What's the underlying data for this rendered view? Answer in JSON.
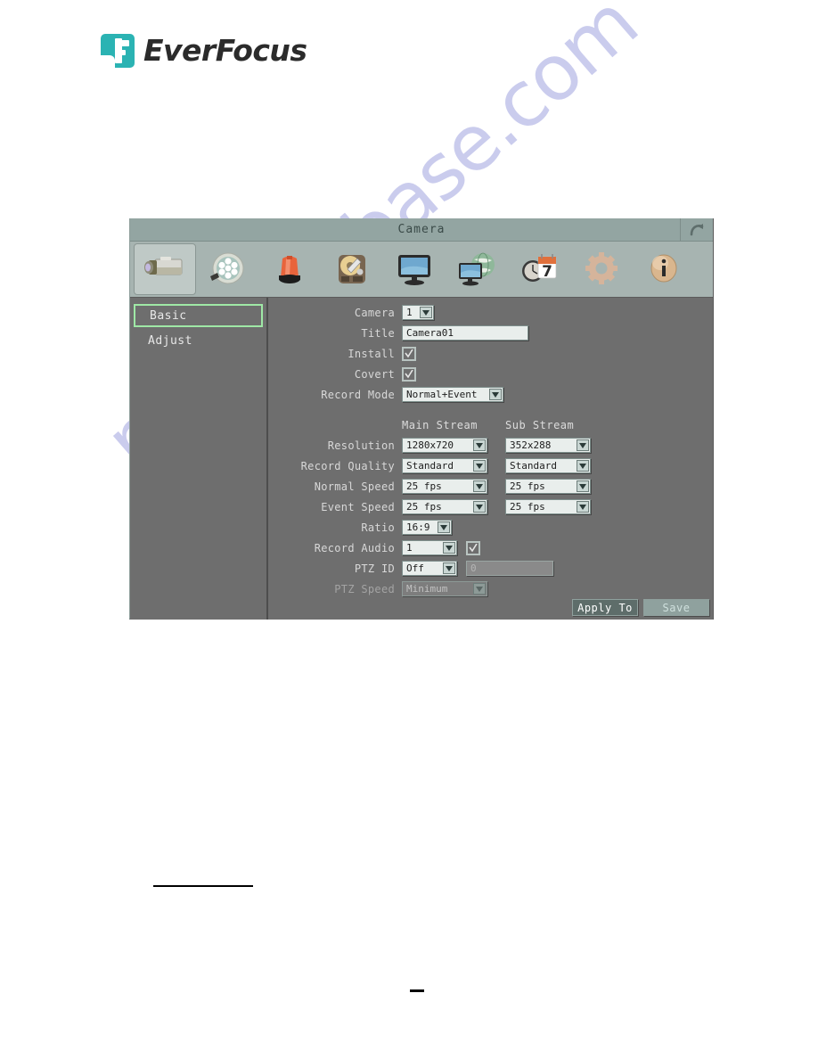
{
  "brand": {
    "name": "EverFocus",
    "logo_color": "#2bb3b3"
  },
  "window": {
    "title": "Camera",
    "back_icon": "back-arrow-icon",
    "toolbar": [
      {
        "name": "camera-icon",
        "label": "Camera",
        "selected": true
      },
      {
        "name": "film-reel-icon",
        "label": "Record",
        "selected": false
      },
      {
        "name": "alarm-light-icon",
        "label": "Alarm",
        "selected": false
      },
      {
        "name": "hard-disk-icon",
        "label": "Disk",
        "selected": false
      },
      {
        "name": "monitor-icon",
        "label": "Display",
        "selected": false
      },
      {
        "name": "network-globe-icon",
        "label": "Network",
        "selected": false
      },
      {
        "name": "clock-calendar-icon",
        "label": "Schedule",
        "selected": false
      },
      {
        "name": "gear-icon",
        "label": "System",
        "selected": false
      },
      {
        "name": "info-icon",
        "label": "Information",
        "selected": false
      }
    ]
  },
  "sidebar": {
    "items": [
      {
        "label": "Basic",
        "active": true
      },
      {
        "label": "Adjust",
        "active": false
      }
    ]
  },
  "form": {
    "camera": {
      "label": "Camera",
      "value": "1"
    },
    "title": {
      "label": "Title",
      "value": "Camera01"
    },
    "install": {
      "label": "Install",
      "checked": true
    },
    "covert": {
      "label": "Covert",
      "checked": true
    },
    "record_mode": {
      "label": "Record Mode",
      "value": "Normal+Event"
    },
    "stream_headers": {
      "main": "Main Stream",
      "sub": "Sub Stream"
    },
    "rows": [
      {
        "label": "Resolution",
        "main": "1280x720",
        "sub": "352x288"
      },
      {
        "label": "Record Quality",
        "main": "Standard",
        "sub": "Standard"
      },
      {
        "label": "Normal Speed",
        "main": "25 fps",
        "sub": "25 fps"
      },
      {
        "label": "Event Speed",
        "main": "25 fps",
        "sub": "25 fps"
      }
    ],
    "ratio": {
      "label": "Ratio",
      "value": "16:9"
    },
    "record_audio": {
      "label": "Record Audio",
      "value": "1",
      "checked": true
    },
    "ptz_id": {
      "label": "PTZ ID",
      "value": "Off",
      "id_value": "0",
      "id_disabled": true
    },
    "ptz_speed": {
      "label": "PTZ Speed",
      "value": "Minimum",
      "disabled": true
    }
  },
  "buttons": {
    "apply_to": "Apply To",
    "save": "Save"
  },
  "watermark": {
    "text": "manualsbase.com",
    "color": "#b9bce8"
  }
}
